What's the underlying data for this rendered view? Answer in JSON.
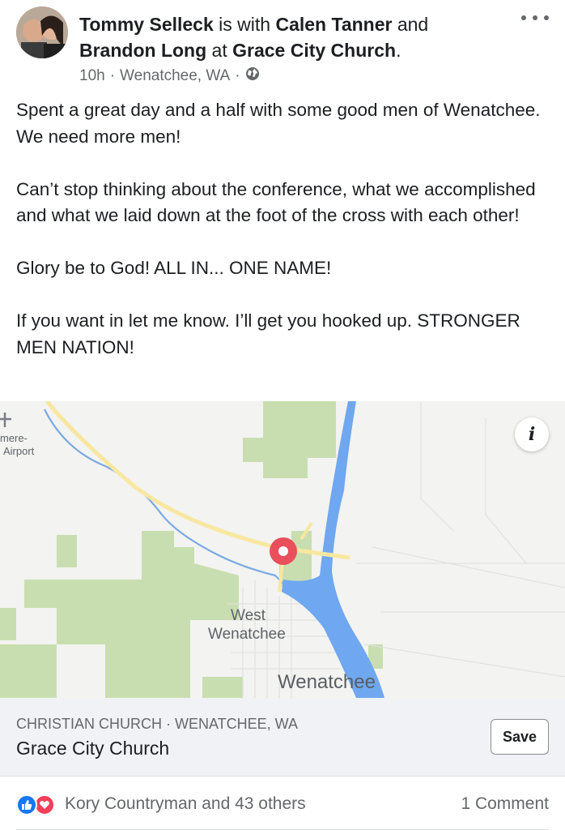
{
  "post": {
    "author": "Tommy Selleck",
    "is_with": " is with ",
    "tag1": "Calen Tanner",
    "and": " and ",
    "tag2": "Brandon Long",
    "at": " at ",
    "location": "Grace City Church",
    "period": ".",
    "time": "10h",
    "separator": "·",
    "place": "Wenatchee, WA",
    "privacy_icon": "globe-icon",
    "more_icon": "more-icon",
    "paragraphs": [
      "Spent a great day and a half with some good men of Wenatchee. We need more men!",
      "Can’t stop thinking about the conference, what we accomplished and what we laid down at the foot of the cross with each other!",
      "Glory be to God! ALL IN... ONE NAME!",
      "If you want in let me know. I’ll get you hooked up. STRONGER MEN NATION!"
    ]
  },
  "map": {
    "labels": {
      "airport_line1": "mere-",
      "airport_line2": "Airport",
      "west_line1": "West",
      "west_line2": "Wenatchee",
      "city": "Wenatchee"
    },
    "info_label": "i",
    "colors": {
      "land": "#f3f3f1",
      "park": "#c9deb0",
      "water": "#6fa7f0",
      "highway": "#f8e7a0",
      "pin": "#ea4f5c"
    }
  },
  "place_card": {
    "category": "CHRISTIAN CHURCH · WENATCHEE, WA",
    "name": "Grace City Church",
    "save_label": "Save"
  },
  "reactions": {
    "text": "Kory Countryman and 43 others",
    "comments": "1 Comment",
    "colors": {
      "like": "#1877f2",
      "love": "#f33e58"
    }
  }
}
